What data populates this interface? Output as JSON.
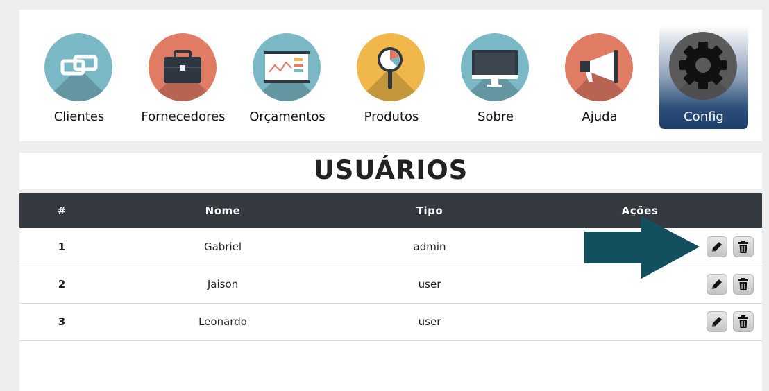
{
  "nav": {
    "items": [
      {
        "label": "Clientes",
        "icon": "link-icon",
        "color": "#7ab8c6"
      },
      {
        "label": "Fornecedores",
        "icon": "briefcase-icon",
        "color": "#e07b64"
      },
      {
        "label": "Orçamentos",
        "icon": "presentation-chart-icon",
        "color": "#7ab8c6"
      },
      {
        "label": "Produtos",
        "icon": "magnifier-chart-icon",
        "color": "#f0b84a"
      },
      {
        "label": "Sobre",
        "icon": "monitor-icon",
        "color": "#7ab8c6"
      },
      {
        "label": "Ajuda",
        "icon": "megaphone-icon",
        "color": "#e07b64"
      },
      {
        "label": "Config",
        "icon": "gear-icon",
        "color": "#5a5a5a",
        "active": true
      }
    ]
  },
  "page": {
    "title": "USUÁRIOS"
  },
  "table": {
    "headers": {
      "index": "#",
      "name": "Nome",
      "type": "Tipo",
      "actions": "Ações"
    },
    "rows": [
      {
        "index": "1",
        "name": "Gabriel",
        "type": "admin"
      },
      {
        "index": "2",
        "name": "Jaison",
        "type": "user"
      },
      {
        "index": "3",
        "name": "Leonardo",
        "type": "user"
      }
    ]
  },
  "colors": {
    "table_header": "#343a40",
    "active_gradient_bottom": "#1d3e69",
    "annotation_arrow": "#13505f"
  }
}
